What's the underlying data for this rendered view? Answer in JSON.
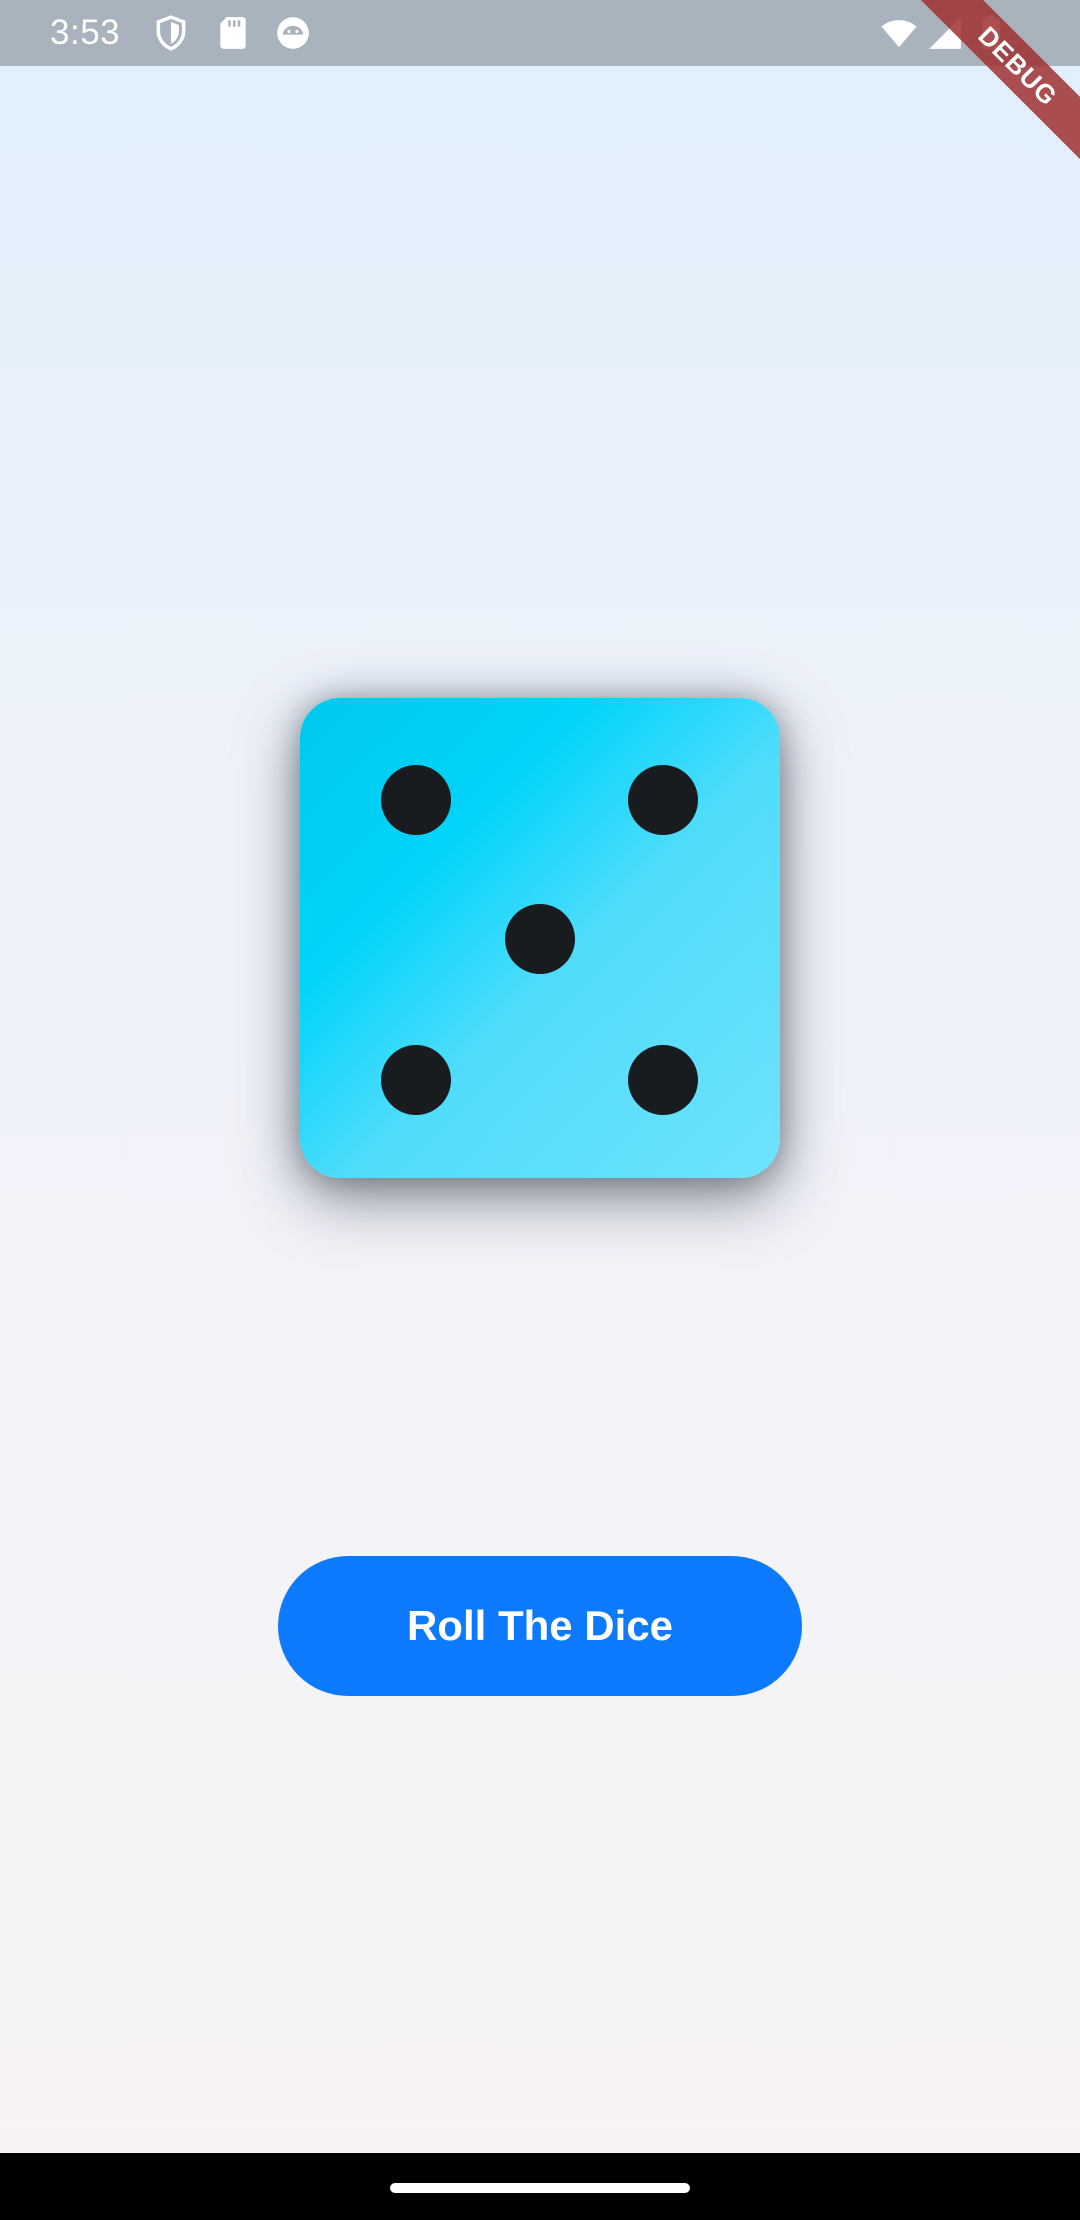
{
  "status_bar": {
    "time": "3:53",
    "left_icons": [
      "shield-icon",
      "sd-card-icon",
      "android-face-icon"
    ],
    "right_icons": [
      "wifi-icon",
      "signal-icon",
      "battery-icon"
    ]
  },
  "debug_banner": {
    "label": "DEBUG"
  },
  "dice": {
    "face_value": 5,
    "colors": {
      "face_start": "#00c8ee",
      "face_end": "#6fe2fd",
      "pip": "#181c1e"
    }
  },
  "roll_button": {
    "label": "Roll The Dice",
    "color": "#0d79fc"
  },
  "nav_bar": {
    "handle": "home-handle"
  }
}
